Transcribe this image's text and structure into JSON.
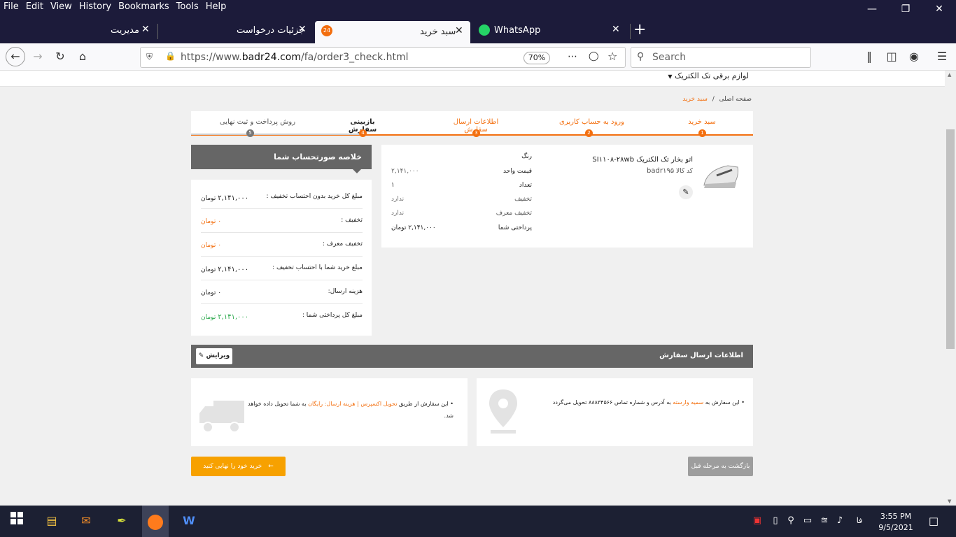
{
  "menubar": {
    "items": [
      "File",
      "Edit",
      "View",
      "History",
      "Bookmarks",
      "Tools",
      "Help"
    ]
  },
  "tabs": [
    {
      "title": "مدیریت",
      "active": false
    },
    {
      "title": "جزئیات درخواست",
      "active": false
    },
    {
      "title": "سبد خرید",
      "active": true
    },
    {
      "title": "WhatsApp",
      "active": false
    }
  ],
  "nav": {
    "url_prefix": "https://www.",
    "url_domain": "badr24.com",
    "url_path": "/fa/order3_check.html",
    "zoom": "70%",
    "search_placeholder": "Search"
  },
  "site": {
    "category_menu": "لوازم برقی تک الکتریک",
    "breadcrumb": {
      "home": "صفحه اصلی",
      "sep": "/",
      "current": "سبد خرید"
    },
    "steps": [
      {
        "label": "سبد خرید",
        "num": "1"
      },
      {
        "label": "ورود به حساب کاربری",
        "num": "2"
      },
      {
        "label": "اطلاعات ارسال سفارش",
        "num": "3"
      },
      {
        "label": "بازبینی سفارش",
        "num": "4"
      },
      {
        "label": "روش پرداخت و ثبت نهایی",
        "num": "5"
      }
    ],
    "product": {
      "name": "اتو بخار تک الکتریک SI۱۱۰۸-۲۸wb",
      "code_label": "کد کالا",
      "code": "badr۱۹۵",
      "rows": [
        {
          "label": "رنگ",
          "value": ""
        },
        {
          "label": "قیمت واحد",
          "value": "۲,۱۴۱,۰۰۰"
        },
        {
          "label": "تعداد",
          "value": "۱"
        },
        {
          "label": "تخفیف",
          "value": "ندارد"
        },
        {
          "label": "تخفیف معرف",
          "value": "ندارد"
        },
        {
          "label": "پرداختی شما",
          "value": "۲,۱۴۱,۰۰۰ تومان"
        }
      ]
    },
    "summary": {
      "title": "خلاصه صورتحساب شما",
      "rows": [
        {
          "label": "مبلغ کل خرید بدون احتساب تخفیف :",
          "value": "۲,۱۴۱,۰۰۰",
          "unit": "تومان"
        },
        {
          "label": "تخفیف :",
          "value": "۰",
          "unit": "تومان"
        },
        {
          "label": "تخفیف معرف :",
          "value": "۰",
          "unit": "تومان"
        },
        {
          "label": "مبلغ خرید شما با احتساب تخفیف :",
          "value": "۲,۱۴۱,۰۰۰",
          "unit": "تومان"
        },
        {
          "label": "هزینه ارسال:",
          "value": "۰",
          "unit": "تومان"
        },
        {
          "label": "مبلغ کل پرداختی شما :",
          "value": "۲,۱۴۱,۰۰۰",
          "unit": "تومان"
        }
      ]
    },
    "shipping": {
      "title": "اطلاعات ارسال سفارش",
      "edit_label": "ویرایش",
      "address_pre": "این سفارش به",
      "address_name": "سمیه وارسته",
      "address_post": "به آدرس و شماره تماس ۸۸۸۳۴۵۶۶ تحویل می‌گردد",
      "delivery_pre": "این سفارش از طریق",
      "delivery_method": "تحویل اکسپرس | هزینه ارسال: رایگان",
      "delivery_post": "به شما تحویل داده خواهد شد."
    },
    "buttons": {
      "back": "بازگشت به مرحله قبل",
      "finish": "خرید خود را نهایی کنید"
    }
  },
  "taskbar": {
    "lang": "فا",
    "time": "3:55 PM",
    "date": "9/5/2021"
  }
}
